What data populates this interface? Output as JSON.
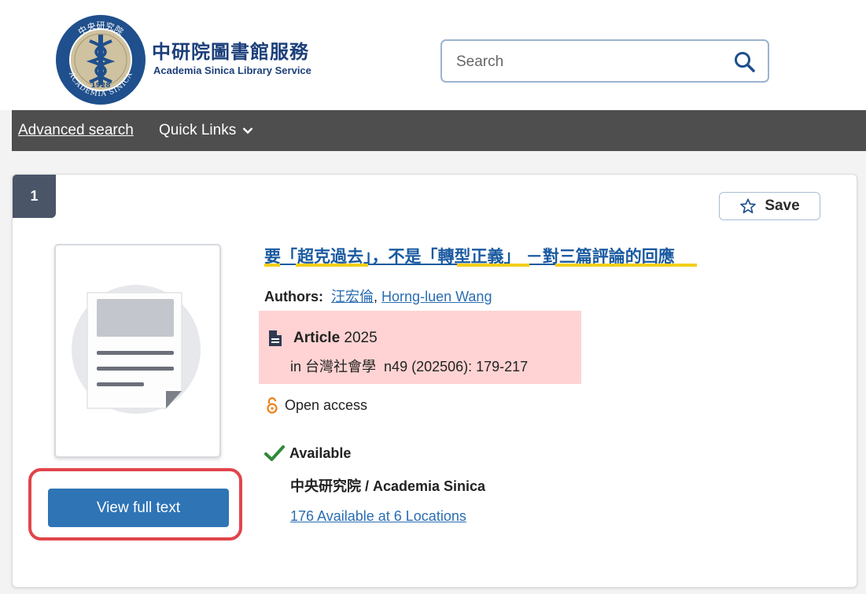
{
  "header": {
    "logo_text": "中央研究院 ACADEMIA SINICA 1928",
    "brand_zh": "中研院圖書館服務",
    "brand_en": "Academia Sinica Library Service"
  },
  "search": {
    "placeholder": "Search",
    "icon": "search-icon"
  },
  "nav": {
    "advanced": "Advanced search",
    "quick_links": "Quick Links",
    "quick_icon": "chevron-down-icon"
  },
  "result": {
    "number": "1",
    "save_label": "Save",
    "title_parts": [
      "要",
      "「",
      "超克過去",
      "」",
      "，不是",
      "「",
      "轉型正義",
      "」",
      " －",
      "對三篇評論的回應"
    ],
    "authors_label": "Authors:",
    "authors": [
      "汪宏倫",
      "Horng-luen Wang"
    ],
    "author_separator": ",",
    "article_type": "Article",
    "year": "2025",
    "source_prefix": "in",
    "source_journal": "台灣社會學",
    "source_detail": "n49 (202506): 179-217",
    "open_access": "Open access",
    "availability": "Available",
    "institution": "中央研究院 / Academia Sinica",
    "locations": "176 Available at 6 Locations",
    "full_text_button": "View full text"
  },
  "colors": {
    "brand": "#1c3f7a",
    "nav_bg": "#4e4e4e",
    "link": "#2a6db3",
    "button": "#2f74b5",
    "highlight": "#ffd3d3",
    "oa": "#f07f1a",
    "check": "#2e8a3a",
    "callout": "#e0454b",
    "underline": "#f3cf1b"
  }
}
